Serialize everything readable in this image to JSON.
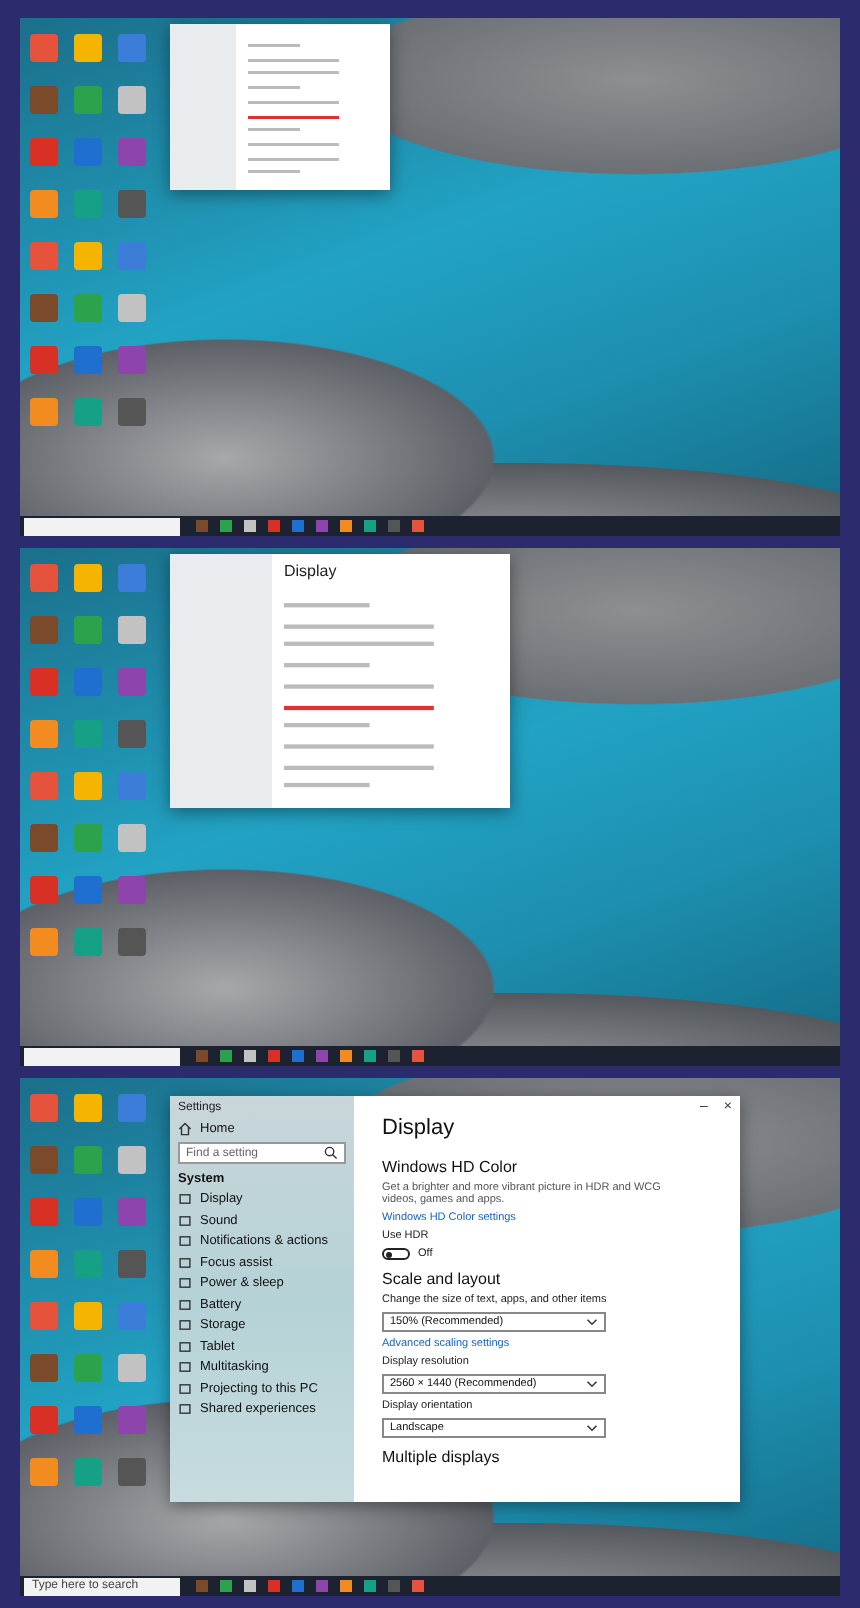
{
  "panels": [
    {
      "kind": "mini"
    },
    {
      "kind": "medium",
      "window": {
        "title": "Display"
      }
    },
    {
      "kind": "full",
      "window": {
        "app_title": "Settings",
        "controls": [
          "–",
          "×"
        ],
        "home": "Home",
        "search_placeholder": "Find a setting",
        "section": "System",
        "nav": [
          {
            "label": "Display"
          },
          {
            "label": "Sound"
          },
          {
            "label": "Notifications & actions"
          },
          {
            "label": "Focus assist"
          },
          {
            "label": "Power & sleep"
          },
          {
            "label": "Battery"
          },
          {
            "label": "Storage"
          },
          {
            "label": "Tablet"
          },
          {
            "label": "Multitasking"
          },
          {
            "label": "Projecting to this PC"
          },
          {
            "label": "Shared experiences"
          }
        ],
        "title": "Display",
        "hd_heading": "Windows HD Color",
        "hd_text": "Get a brighter and more vibrant picture in HDR and WCG videos, games and apps.",
        "hd_link": "Windows HD Color settings",
        "hdr": {
          "label": "Use HDR",
          "on": false,
          "state_text": "Off"
        },
        "scale_heading": "Scale and layout",
        "settings": [
          {
            "kind": "dropdown",
            "label": "Change the size of text, apps, and other items",
            "value": "150% (Recommended)"
          },
          {
            "kind": "link",
            "label": "Advanced scaling settings"
          },
          {
            "kind": "dropdown",
            "label": "Display resolution",
            "value": "2560 × 1440 (Recommended)"
          },
          {
            "kind": "dropdown",
            "label": "Display orientation",
            "value": "Landscape"
          }
        ],
        "next_heading": "Multiple displays"
      },
      "taskbar": {
        "search_placeholder": "Type here to search"
      }
    }
  ]
}
